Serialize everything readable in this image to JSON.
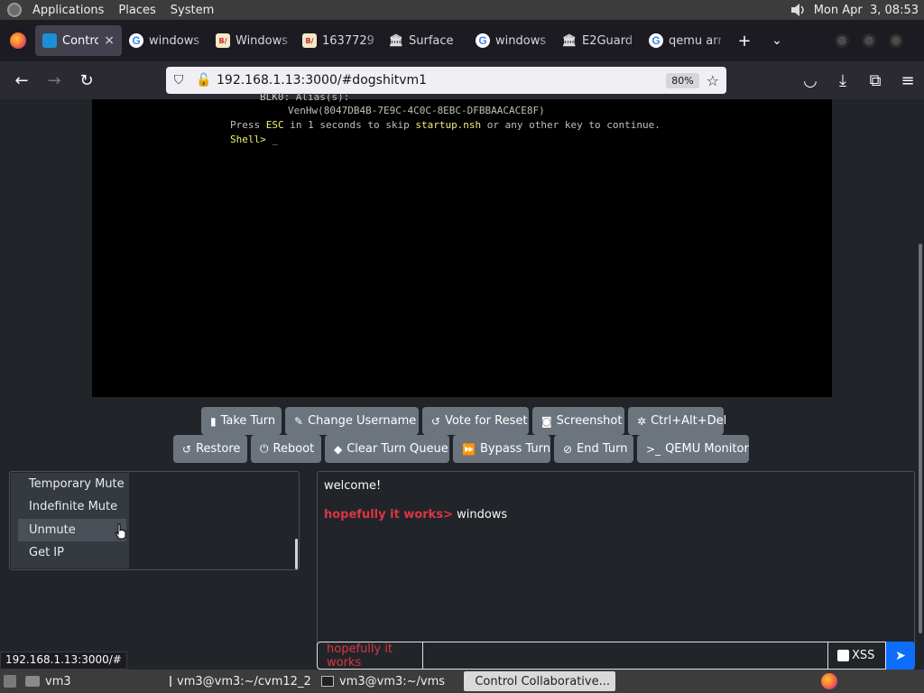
{
  "top_panel": {
    "menus": [
      "Applications",
      "Places",
      "System"
    ],
    "clock": "Mon Apr  3, 08:53"
  },
  "tabs": [
    {
      "title": "Contro",
      "icon": "monitor-icon",
      "active": true
    },
    {
      "title": "windows",
      "icon": "google-icon"
    },
    {
      "title": "Windows",
      "icon": "bw-icon"
    },
    {
      "title": "1637729",
      "icon": "bw-icon"
    },
    {
      "title": "Surface",
      "icon": "bank-icon"
    },
    {
      "title": "windows",
      "icon": "google-icon"
    },
    {
      "title": "E2Guard",
      "icon": "bank-icon"
    },
    {
      "title": "qemu arr",
      "icon": "google-icon"
    }
  ],
  "address_bar": {
    "url": "192.168.1.13:3000/#dogshitvm1",
    "zoom": "80%"
  },
  "vm_screen": {
    "line_partial": "BLK0: Alias(s):",
    "line_vendor": "VenHw(8047DB4B-7E9C-4C0C-8EBC-DFBBAACACE8F)",
    "press_pre": "Press ",
    "press_key": "ESC",
    "press_mid": " in 1 seconds to skip ",
    "press_script": "startup.nsh",
    "press_post": " or any other key to continue.",
    "prompt": "Shell> ",
    "cursor": "_"
  },
  "buttons_row1": [
    {
      "label": "Take Turn",
      "icon": "mouse-icon",
      "glyph": "▮"
    },
    {
      "label": "Change Username",
      "icon": "user-edit-icon",
      "glyph": "✎"
    },
    {
      "label": "Vote for Reset",
      "icon": "undo-icon",
      "glyph": "↺"
    },
    {
      "label": "Screenshot",
      "icon": "camera-icon",
      "glyph": "◙"
    },
    {
      "label": "Ctrl+Alt+Del",
      "icon": "gear-icon",
      "glyph": "✲"
    }
  ],
  "buttons_row2": [
    {
      "label": "Restore",
      "icon": "restore-icon",
      "glyph": "↺"
    },
    {
      "label": "Reboot",
      "icon": "power-icon",
      "glyph": "⏻"
    },
    {
      "label": "Clear Turn Queue",
      "icon": "eraser-icon",
      "glyph": "◆"
    },
    {
      "label": "Bypass Turn",
      "icon": "fast-forward-icon",
      "glyph": "⏩"
    },
    {
      "label": "End Turn",
      "icon": "ban-icon",
      "glyph": "⊘"
    },
    {
      "label": "QEMU Monitor",
      "icon": "terminal-icon",
      "glyph": ">_"
    }
  ],
  "context_menu": [
    "Temporary Mute",
    "Indefinite Mute",
    "Unmute",
    "Get IP"
  ],
  "chat": {
    "welcome": "welcome!",
    "messages": [
      {
        "user": "hopefully it works>",
        "text": " windows"
      }
    ],
    "username": "hopefully it works",
    "input_value": "",
    "xss_label": "XSS"
  },
  "status_link": "192.168.1.13:3000/#",
  "taskbar": [
    {
      "label": "vm3",
      "icon": "folder-icon"
    },
    {
      "label": "vm3@vm3:~/cvm12_2",
      "icon": "terminal-icon"
    },
    {
      "label": "vm3@vm3:~/vms",
      "icon": "terminal-icon"
    },
    {
      "label": "Control Collaborative...",
      "icon": "firefox-icon",
      "active": true
    }
  ]
}
